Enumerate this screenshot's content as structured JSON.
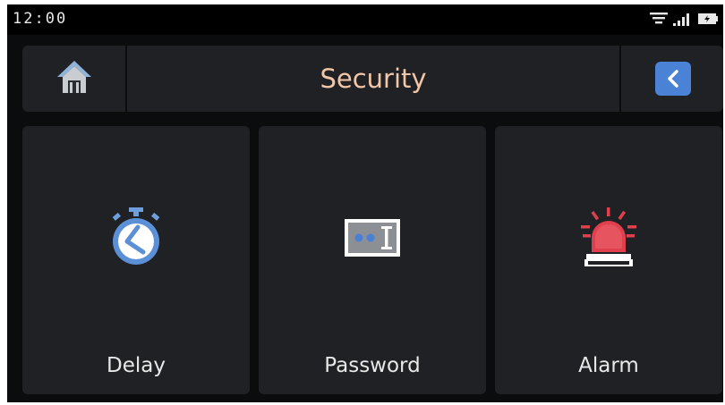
{
  "status_bar": {
    "time": "12:00",
    "icons": [
      "wifi-icon",
      "signal-icon",
      "battery-icon"
    ]
  },
  "header": {
    "title": "Security",
    "home_icon": "home-icon",
    "back_icon": "back-chevron-icon"
  },
  "tiles": [
    {
      "label": "Delay",
      "icon": "stopwatch-icon"
    },
    {
      "label": "Password",
      "icon": "password-field-icon"
    },
    {
      "label": "Alarm",
      "icon": "alarm-siren-icon"
    }
  ],
  "colors": {
    "background": "#0b0c0e",
    "panel": "#1f2124",
    "title": "#f2c6a6",
    "accent_blue": "#4a82d6",
    "alarm_red": "#e0404e"
  }
}
